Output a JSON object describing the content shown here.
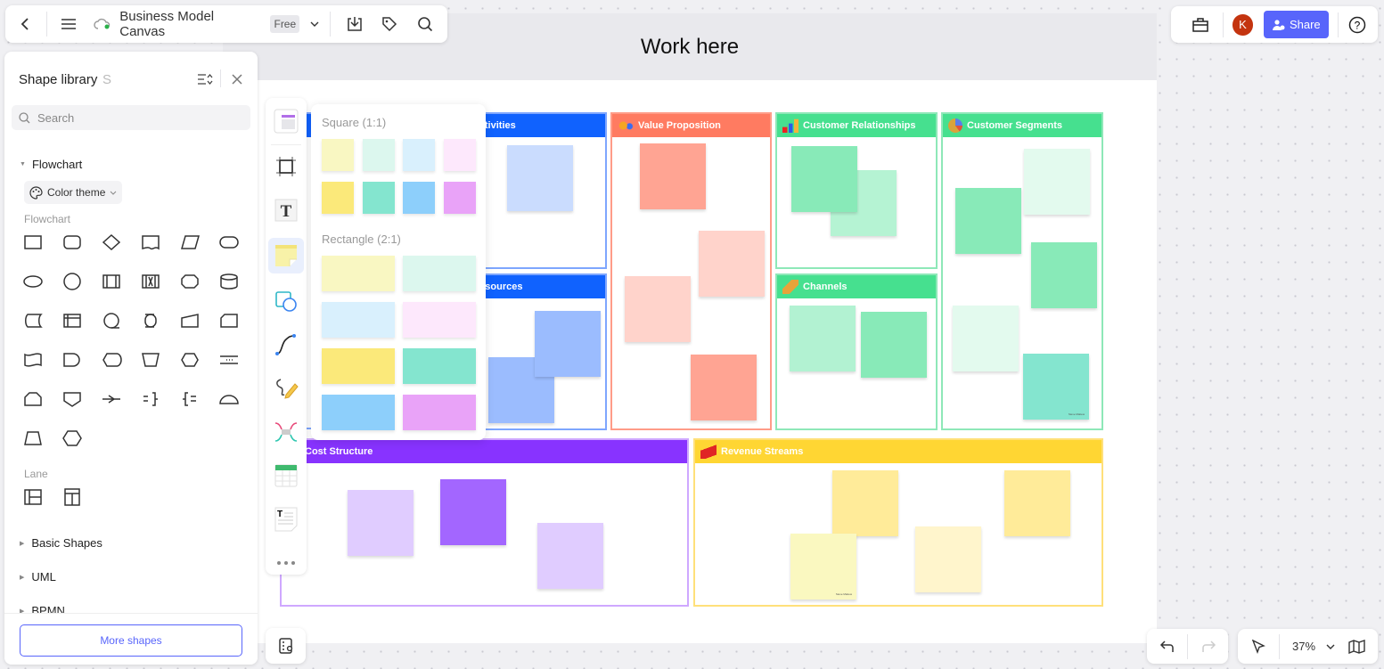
{
  "topbar": {
    "title": "Business Model Canvas",
    "badge": "Free"
  },
  "right_bar": {
    "avatar": "K",
    "share": "Share"
  },
  "board": {
    "title": "Work here",
    "sections": {
      "key_activities": "Key Activities",
      "key_resources": "Key Resources",
      "value_proposition": "Value Proposition",
      "customer_relationships": "Customer Relationships",
      "channels": "Channels",
      "customer_segments": "Customer Segments",
      "cost_structure": "Cost Structure",
      "revenue_streams": "Revenue Streams"
    },
    "sticky_author": "Steve Mattew",
    "colors": {
      "blue": "#1062fe",
      "salmon": "#ff7b61",
      "green": "#46e08f",
      "purple": "#8833ff",
      "yellow": "#ffd633"
    }
  },
  "library": {
    "title": "Shape library",
    "shortcut": "S",
    "search_placeholder": "Search",
    "category": "Flowchart",
    "color_theme": "Color theme",
    "group_flowchart": "Flowchart",
    "group_lane": "Lane",
    "collapsed": [
      "Basic Shapes",
      "UML",
      "BPMN"
    ],
    "more": "More shapes",
    "shapes": [
      "process",
      "rounded-rect",
      "decision",
      "document",
      "data",
      "terminator",
      "ellipse",
      "circle",
      "predefined-process",
      "parallel-mode",
      "alternate-process",
      "database",
      "stored-data",
      "internal-storage",
      "sequential-data",
      "direct-data",
      "manual-input",
      "card",
      "punched-tape",
      "delay",
      "display",
      "manual-operation",
      "preparation",
      "horizontal-lines",
      "loop-limit",
      "off-page",
      "summing",
      "annotation-right",
      "annotation-left",
      "half-circle",
      "trapezoid",
      "hexagon"
    ],
    "lanes": [
      "horizontal-lane",
      "vertical-lane"
    ]
  },
  "sticky_popup": {
    "square": "Square (1:1)",
    "rectangle": "Rectangle (2:1)",
    "square_colors": [
      "#f9f7c2",
      "#dcf7ee",
      "#d9f0fd",
      "#fde8fc",
      "#fbe97a",
      "#84e5cf",
      "#8dcffb",
      "#e9a3f8"
    ],
    "rect_colors": [
      "#f9f7c2",
      "#dcf7ee",
      "#d9f0fd",
      "#fde8fc",
      "#fbe97a",
      "#84e5cf",
      "#8dcffb",
      "#e9a3f8"
    ]
  },
  "zoom": {
    "level": "37%"
  }
}
